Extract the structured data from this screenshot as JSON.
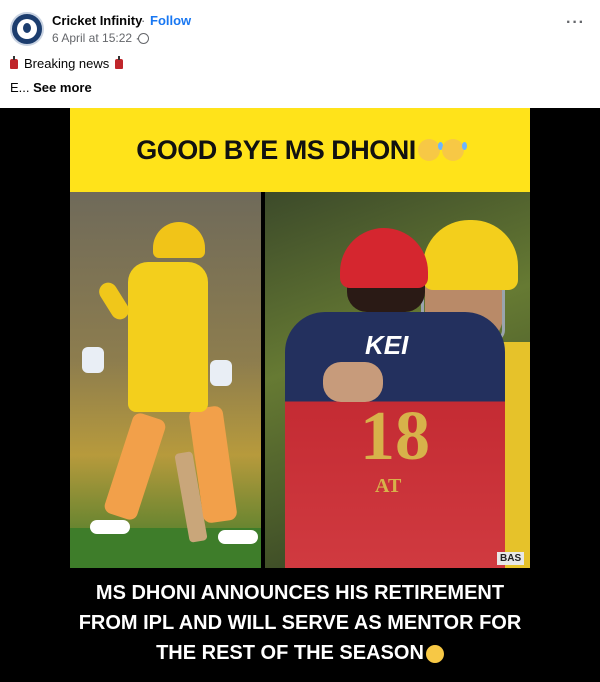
{
  "post": {
    "page_name": "Cricket Infinity",
    "separator": "·",
    "follow_label": "Follow",
    "timestamp": "6 April at 15:22 ·",
    "more_menu": "···",
    "caption_line1": "Breaking news",
    "caption_line2_prefix": "E...",
    "see_more": "See more"
  },
  "image": {
    "headline": "GOOD BYE MS DHONI",
    "jersey_brand": "KEI",
    "jersey_number": "18",
    "jersey_name": "AT",
    "bas_tag": "BAS",
    "body_lines": [
      "MS DHONI ANNOUNCES HIS RETIREMENT",
      "FROM IPL AND WILL SERVE AS MENTOR FOR",
      "THE REST OF THE SEASON"
    ]
  },
  "colors": {
    "follow": "#1877f2",
    "headline_band": "#ffe31a",
    "media_bg": "#000000"
  },
  "icons": {
    "avatar": "cricket-infinity-logo",
    "privacy": "globe-icon",
    "menu": "more-icon",
    "emoji_headline": "sad-face-emoji",
    "emoji_body": "sad-face-emoji",
    "breaking": "red-fez-emoji"
  }
}
